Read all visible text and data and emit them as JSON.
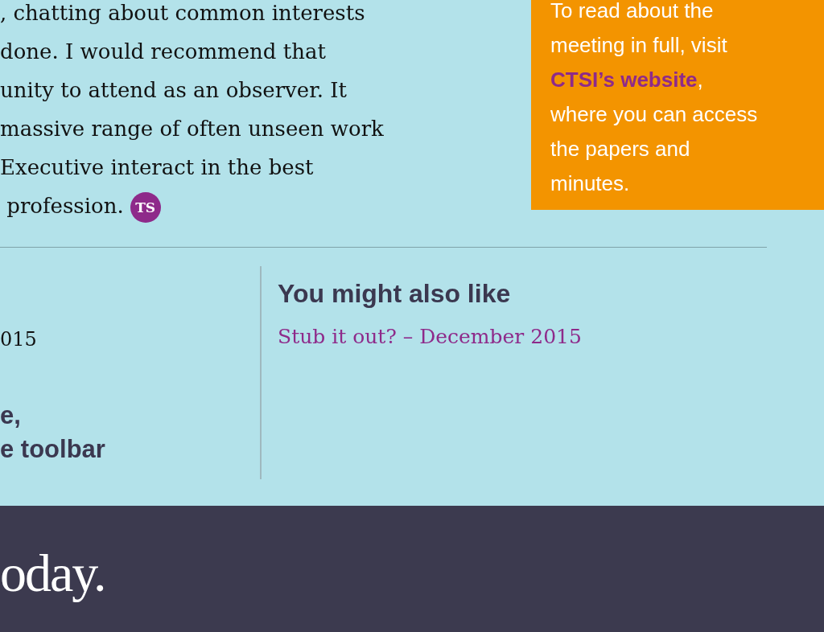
{
  "article": {
    "lines": [
      ", chatting about common interests",
      "done. I would recommend that",
      "unity to attend as an observer. It",
      "massive range of often unseen work",
      "Executive interact in the best",
      " profession."
    ],
    "author_badge": "TS"
  },
  "callout": {
    "before": "To read about the meeting in full, visit",
    "link": "CTSI’s website",
    "after": ", where you can access the papers and minutes."
  },
  "left_column": {
    "date_text": "015",
    "share_lines": [
      "e,",
      "e toolbar"
    ]
  },
  "related": {
    "heading": "You might also like",
    "links": [
      "Stub it out? – December 2015"
    ]
  },
  "footer": {
    "logo_text": "oday."
  }
}
